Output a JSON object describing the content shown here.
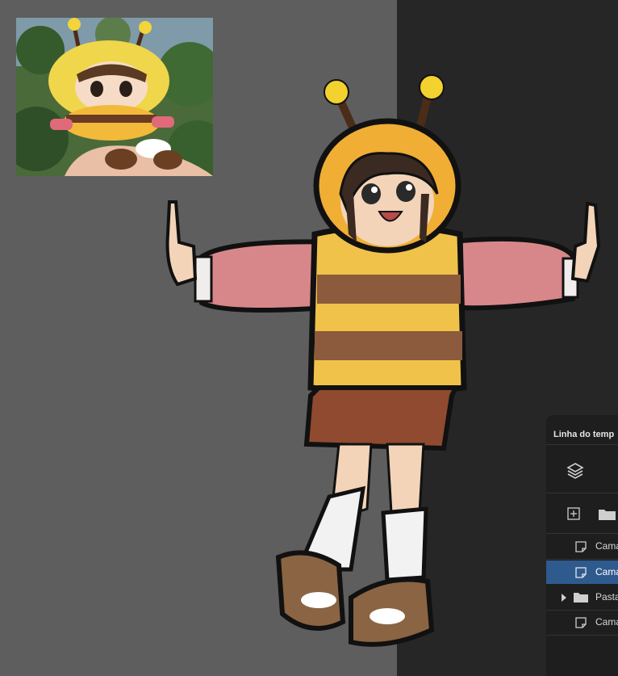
{
  "reference_image": {
    "subject": "bee costume plush doll held in hand"
  },
  "artwork": {
    "subject": "girl in bee hoodie with antennae, striped sweater, red skirt, white socks, brown shoes, arms outstretched"
  },
  "timeline_panel": {
    "title": "Linha do temp",
    "layers_icon": "layers-stack-icon",
    "add_layer_icon": "add-layer-icon",
    "add_folder_icon": "folder-icon",
    "rows": [
      {
        "label": "Cama",
        "icon": "layer-page-icon",
        "selected": false
      },
      {
        "label": "Cama",
        "icon": "layer-page-icon",
        "selected": true
      },
      {
        "label": "Pasta",
        "icon": "folder-icon",
        "selected": false
      },
      {
        "label": "Cama",
        "icon": "layer-page-icon",
        "selected": false
      }
    ]
  },
  "colors": {
    "canvas_left": "#5e5e5e",
    "canvas_right": "#262626",
    "panel_bg": "#1e1e1e",
    "selected_row": "#2f5a8e"
  }
}
